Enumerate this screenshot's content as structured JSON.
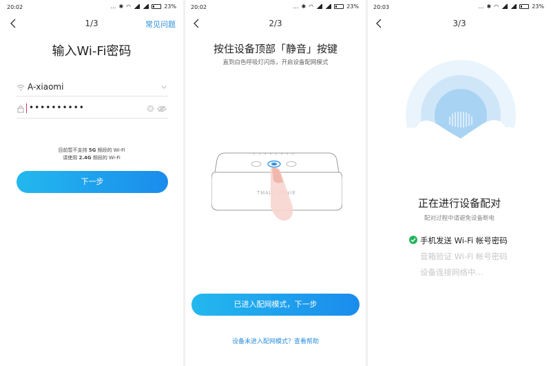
{
  "p1": {
    "time": "20:02",
    "battery": "23%",
    "step": "1/3",
    "faq_link": "常见问题",
    "title": "输入Wi-Fi密码",
    "ssid": "A-xiaomi",
    "password_masked": "••••••••••",
    "notice_line1_a": "目前暂不支持 ",
    "notice_line1_b": "5G",
    "notice_line1_c": " 频段的 Wi-Fi",
    "notice_line2_a": "请使用 ",
    "notice_line2_b": "2.4G",
    "notice_line2_c": " 频段的 Wi-Fi",
    "next_button": "下一步"
  },
  "p2": {
    "time": "20:02",
    "battery": "23%",
    "step": "2/3",
    "title": "按住设备顶部「静音」按键",
    "subtitle": "直到白色呼吸灯闪烁，开启设备配网模式",
    "device_brand": "TMALL GENIE",
    "confirm_button": "已进入配网模式，下一步",
    "help_link": "设备未进入配网模式？查看帮助"
  },
  "p3": {
    "time": "20:03",
    "battery": "23%",
    "step": "3/3",
    "title": "正在进行设备配对",
    "subtitle": "配对过程中请避免设备断电",
    "steps": [
      {
        "label": "手机发送 Wi-Fi 帐号密码",
        "done": true
      },
      {
        "label": "音箱验证 Wi-Fi 帐号密码",
        "done": false
      },
      {
        "label": "设备连接网络中...",
        "done": false
      }
    ]
  },
  "colors": {
    "accent": "#2a8fdc",
    "button_start": "#23b8ee",
    "button_end": "#1a8cec",
    "success": "#1fb65a",
    "pending_text": "#c8c8c8"
  }
}
